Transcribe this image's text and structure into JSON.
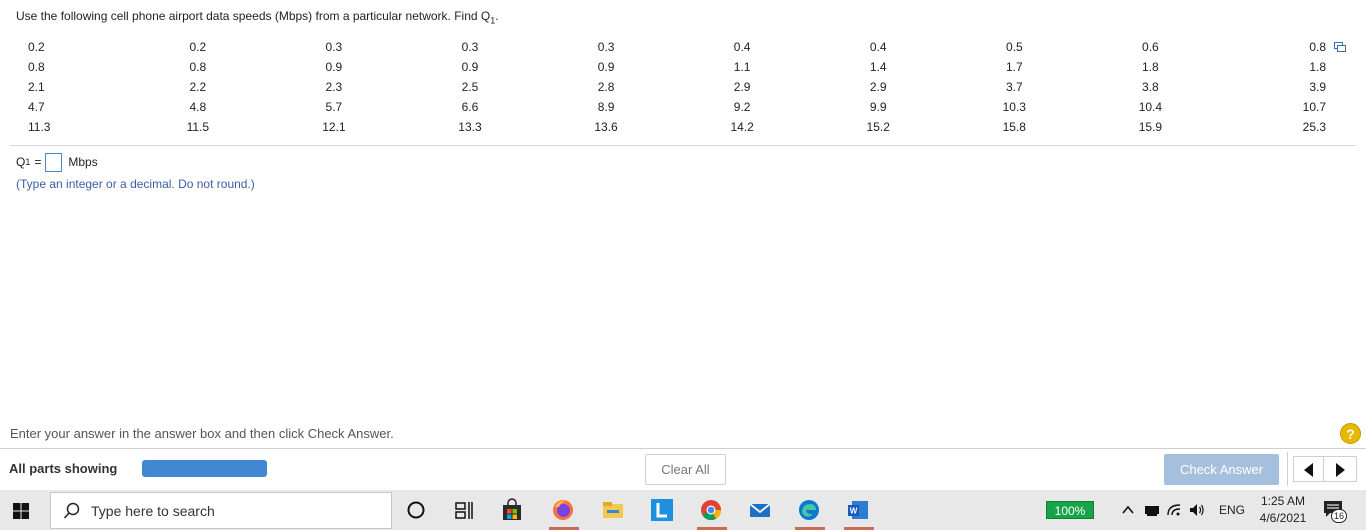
{
  "question": {
    "prefix": "Use the following cell phone airport data speeds (Mbps) from a particular network. Find Q",
    "subscript": "1",
    "suffix": "."
  },
  "data_table": {
    "rows": [
      [
        "0.2",
        "0.2",
        "0.3",
        "0.3",
        "0.3",
        "0.4",
        "0.4",
        "0.5",
        "0.6",
        "0.8"
      ],
      [
        "0.8",
        "0.8",
        "0.9",
        "0.9",
        "0.9",
        "1.1",
        "1.4",
        "1.7",
        "1.8",
        "1.8"
      ],
      [
        "2.1",
        "2.2",
        "2.3",
        "2.5",
        "2.8",
        "2.9",
        "2.9",
        "3.7",
        "3.8",
        "3.9"
      ],
      [
        "4.7",
        "4.8",
        "5.7",
        "6.6",
        "8.9",
        "9.2",
        "9.9",
        "10.3",
        "10.4",
        "10.7"
      ],
      [
        "11.3",
        "11.5",
        "12.1",
        "13.3",
        "13.6",
        "14.2",
        "15.2",
        "15.8",
        "15.9",
        "25.3"
      ]
    ]
  },
  "answer": {
    "label": "Q",
    "subscript": "1",
    "equals": "=",
    "value": "",
    "unit": "Mbps",
    "hint": "(Type an integer or a decimal. Do not round.)"
  },
  "footer": {
    "instruction": "Enter your answer in the answer box and then click Check Answer.",
    "help_label": "?",
    "parts_label": "All parts showing",
    "progress": 1.0,
    "clear_label": "Clear All",
    "check_label": "Check Answer"
  },
  "taskbar": {
    "search_placeholder": "Type here to search",
    "battery": "100%",
    "language": "ENG",
    "time": "1:25 AM",
    "date": "4/6/2021",
    "notification_count": "16",
    "colors": {
      "battery": "#17a34a",
      "accent": "#4187d1"
    }
  }
}
